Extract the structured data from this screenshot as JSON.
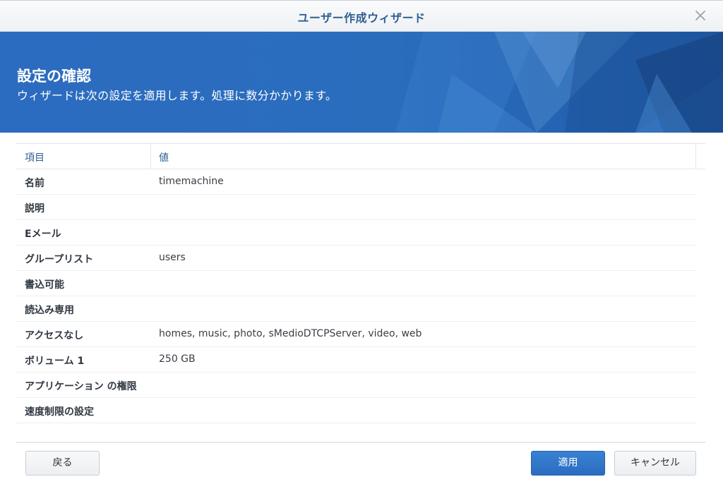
{
  "window": {
    "title": "ユーザー作成ウィザード"
  },
  "banner": {
    "title": "設定の確認",
    "subtitle": "ウィザードは次の設定を適用します。処理に数分かかります。"
  },
  "table": {
    "headers": [
      "項目",
      "値"
    ],
    "rows": [
      {
        "key": "名前",
        "value": "timemachine"
      },
      {
        "key": "説明",
        "value": ""
      },
      {
        "key": "Eメール",
        "value": ""
      },
      {
        "key": "グループリスト",
        "value": "users"
      },
      {
        "key": "書込可能",
        "value": ""
      },
      {
        "key": "読込み専用",
        "value": ""
      },
      {
        "key": "アクセスなし",
        "value": "homes, music, photo, sMedioDTCPServer, video, web"
      },
      {
        "key": "ボリューム 1",
        "value": "250 GB"
      },
      {
        "key": "アプリケーション の権限",
        "value": ""
      },
      {
        "key": "速度制限の設定",
        "value": ""
      }
    ]
  },
  "buttons": {
    "back": "戻る",
    "apply": "適用",
    "cancel": "キャンセル"
  },
  "colors": {
    "accent": "#2a6fbf",
    "title_text": "#2f5f93",
    "header_text": "#2e5e95"
  },
  "icons": {
    "close": "close-icon"
  }
}
